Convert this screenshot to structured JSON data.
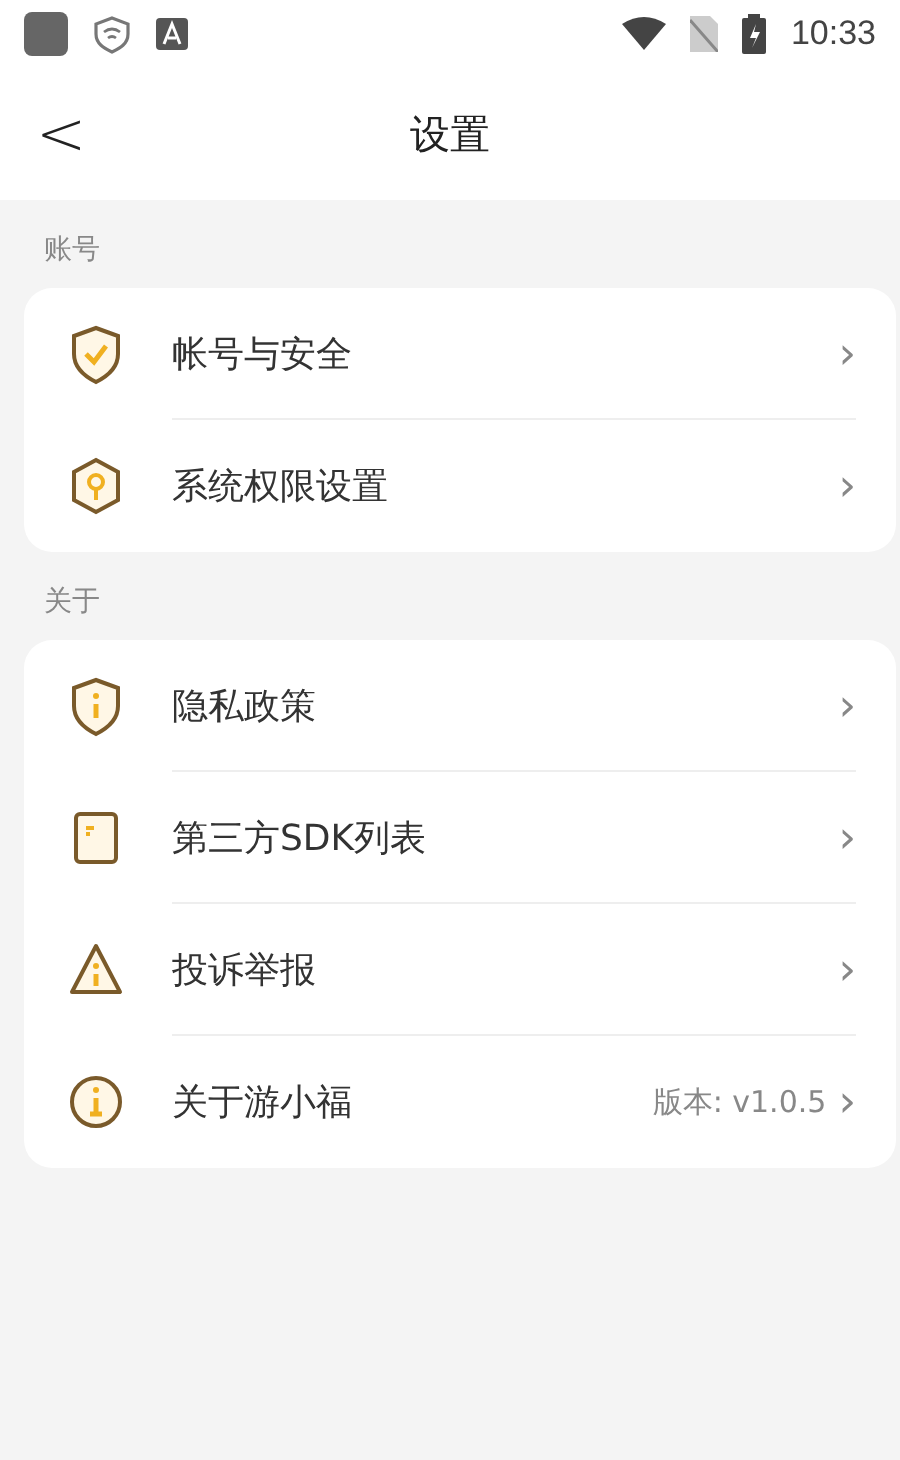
{
  "status_bar": {
    "time": "10:33"
  },
  "header": {
    "back": "<",
    "title": "设置"
  },
  "sections": [
    {
      "label": "账号",
      "items": [
        {
          "kind": "shield-check",
          "label": "帐号与安全",
          "chevron": "›"
        },
        {
          "kind": "hex-key",
          "label": "系统权限设置",
          "chevron": "›"
        }
      ]
    },
    {
      "label": "关于",
      "items": [
        {
          "kind": "shield-info",
          "label": "隐私政策",
          "chevron": "›"
        },
        {
          "kind": "document",
          "label": "第三方SDK列表",
          "chevron": "›"
        },
        {
          "kind": "warning",
          "label": "投诉举报",
          "chevron": "›"
        },
        {
          "kind": "info",
          "label": "关于游小福",
          "value": "版本: v1.0.5",
          "chevron": "›"
        }
      ]
    }
  ]
}
